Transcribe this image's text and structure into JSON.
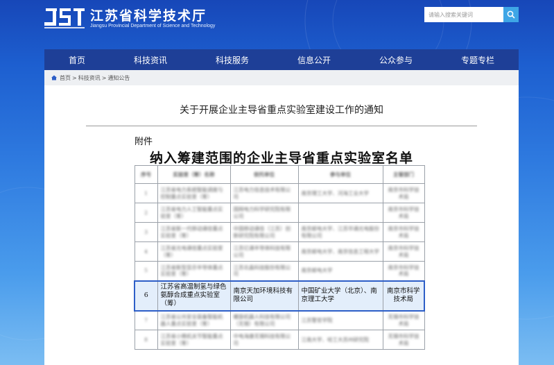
{
  "header": {
    "logo_cn": "江苏省科学技术厅",
    "logo_en": "Jiangsu Provincial Department of Science and Technology",
    "search_placeholder": "请输入搜索关键词"
  },
  "nav": {
    "items": [
      "首页",
      "科技资讯",
      "科技服务",
      "信息公开",
      "公众参与",
      "专题专栏"
    ]
  },
  "breadcrumb": [
    "首页",
    "科技资讯",
    "通知公告"
  ],
  "article": {
    "title": "关于开展企业主导省重点实验室建设工作的通知",
    "attachment_label": "附件",
    "list_title": "纳入筹建范围的企业主导省重点实验室名单"
  },
  "table": {
    "headers": [
      "序号",
      "实验室（筹）名称",
      "依托单位",
      "参与单位",
      "主管部门"
    ],
    "rows": [
      [
        "1",
        "江苏省电力系统智能调度与控制重点实验室（筹）",
        "江苏电力信息技术有限公司",
        "南京理工大学、河海工业大学",
        "南京市科学技术局"
      ],
      [
        "2",
        "江苏省电力人工智能重点实验室（筹）",
        "国网电力科学研究院有限公司",
        "",
        "南京市科学技术局"
      ],
      [
        "3",
        "江苏省新一代移动通信重点实验室（筹）",
        "中国移动通信（江苏）创新研究院有限公司",
        "南京邮电大学、江苏华通光电股份有限公司",
        "南京市科学技术局"
      ],
      [
        "4",
        "江苏省光电通信重点实验室（筹）",
        "江苏亿通半导体科技有限公司",
        "南京邮电大学、南京信息工程大学",
        "南京市科学技术局"
      ],
      [
        "5",
        "江苏省新型显示半导体重点实验室（筹）",
        "江苏北晶科技股份有限公司",
        "南京邮电大学",
        "南京市科学技术局"
      ],
      [
        "6",
        "江苏省高温制氢与绿色氨醇合成重点实验室（筹）",
        "南京天加环境科技有限公司",
        "中国矿业大学（北京）、南京理工大学",
        "南京市科学技术局"
      ],
      [
        "7",
        "江苏省公共安全装备智能机器人重点实验室（筹）",
        "螺旋机器人科技有限公司（无锡）有限公司",
        "江苏警官学院",
        "无锡市科学技术局"
      ],
      [
        "8",
        "江苏省小微机关节智能重点实验室（筹）",
        "中电海康无锡科技有限公司",
        "江南大学、哈工大苏州研究院",
        "无锡市科学技术局"
      ]
    ],
    "highlight_row_index": 5
  }
}
